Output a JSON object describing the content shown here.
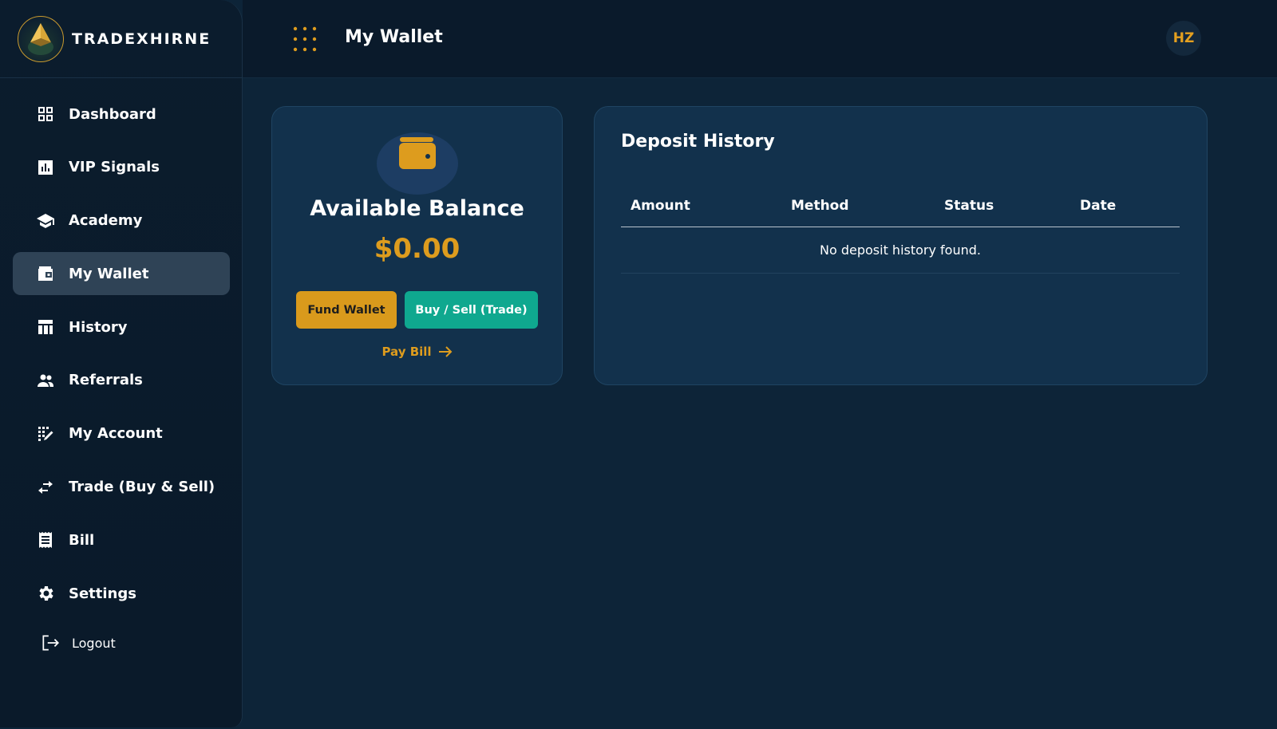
{
  "brand": {
    "name": "TRADEXHIRNE"
  },
  "colors": {
    "accent": "#dd9c1e",
    "teal": "#0fa88f",
    "active": "#2f4356"
  },
  "sidebar": {
    "items": [
      {
        "label": "Dashboard",
        "icon": "dashboard-icon",
        "active": false
      },
      {
        "label": "VIP Signals",
        "icon": "bar-chart-icon",
        "active": false
      },
      {
        "label": "Academy",
        "icon": "graduation-cap-icon",
        "active": false
      },
      {
        "label": "My Wallet",
        "icon": "wallet-icon",
        "active": true
      },
      {
        "label": "History",
        "icon": "table-icon",
        "active": false
      },
      {
        "label": "Referrals",
        "icon": "people-icon",
        "active": false
      },
      {
        "label": "My Account",
        "icon": "edit-grid-icon",
        "active": false
      },
      {
        "label": "Trade (Buy & Sell)",
        "icon": "swap-arrows-icon",
        "active": false
      },
      {
        "label": "Bill",
        "icon": "receipt-icon",
        "active": false
      },
      {
        "label": "Settings",
        "icon": "gear-icon",
        "active": false
      }
    ],
    "logout": "Logout"
  },
  "header": {
    "title": "My Wallet",
    "avatar_initials": "HZ"
  },
  "balance": {
    "label": "Available Balance",
    "amount": "$0.00",
    "fund_label": "Fund Wallet",
    "trade_label": "Buy / Sell (Trade)",
    "paybill_label": "Pay Bill"
  },
  "deposits": {
    "title": "Deposit History",
    "columns": [
      "Amount",
      "Method",
      "Status",
      "Date"
    ],
    "empty_message": "No deposit history found."
  }
}
